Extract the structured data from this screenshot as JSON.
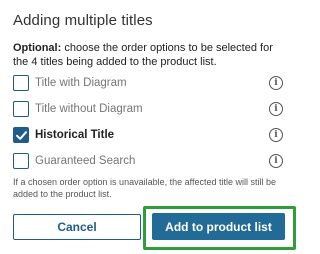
{
  "dialog": {
    "title": "Adding multiple titles",
    "description_bold": "Optional:",
    "description_rest": " choose the order options to be selected for the 4 titles being added to the product list.",
    "options": [
      {
        "label": "Title with Diagram",
        "checked": false
      },
      {
        "label": "Title without Diagram",
        "checked": false
      },
      {
        "label": "Historical Title",
        "checked": true
      },
      {
        "label": "Guaranteed Search",
        "checked": false
      }
    ],
    "info_glyph": "i",
    "note": "If a chosen order option is unavailable, the affected title will still be added to the product list.",
    "cancel_label": "Cancel",
    "add_label": "Add to product list"
  },
  "colors": {
    "accent": "#1f5c8b",
    "primary_button": "#226b96",
    "highlight": "#2e9e3b"
  },
  "icons": {
    "info": "info-icon",
    "check": "checkmark-icon"
  }
}
